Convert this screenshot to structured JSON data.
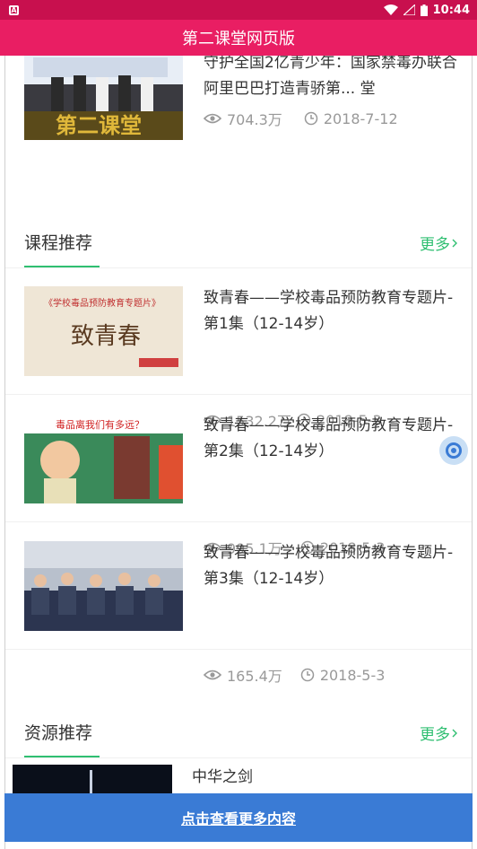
{
  "status_bar": {
    "time": "10:44"
  },
  "app_bar": {
    "title": "第二课堂网页版"
  },
  "top_item": {
    "title": "守护全国2亿青少年：国家禁毒办联合阿里巴巴打造青骄第... 堂",
    "views": "704.3万",
    "date": "2018-7-12"
  },
  "course_section": {
    "title": "课程推荐",
    "more": "更多"
  },
  "courses": [
    {
      "title": "致青春——学校毒品预防教育专题片-第1集（12-14岁）",
      "views": "1532.2万",
      "date": "2018-5-3"
    },
    {
      "title": "致青春——学校毒品预防教育专题片-第2集（12-14岁）",
      "views": "995.1万",
      "date": "2018-5-3"
    },
    {
      "title": "致青春——学校毒品预防教育专题片-第3集（12-14岁）",
      "views": "165.4万",
      "date": "2018-5-3"
    }
  ],
  "resource_section": {
    "title": "资源推荐",
    "more": "更多"
  },
  "resource_item": {
    "title": "中华之剑"
  },
  "bottom_button": {
    "label": "点击查看更多内容"
  },
  "colors": {
    "status_bar": "#c8104e",
    "app_bar": "#e91e63",
    "accent_green": "#2fbf71",
    "button_blue": "#3a7bd5"
  }
}
